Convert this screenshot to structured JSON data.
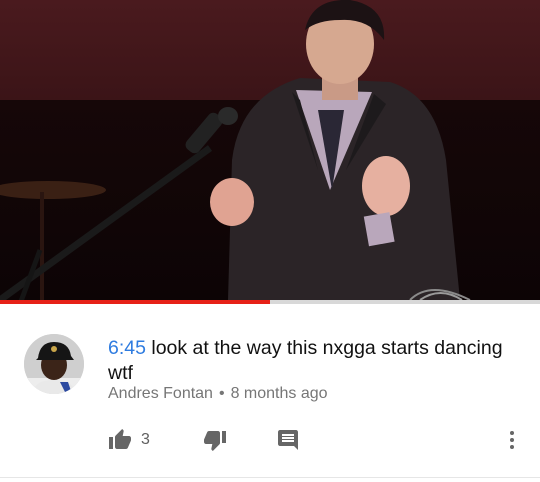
{
  "video": {
    "progress_fraction": 0.5,
    "progress_color": "#e62117"
  },
  "comment": {
    "timestamp": "6:45",
    "text": " look at the way this nxgga starts dancing wtf",
    "author": "Andres Fontan",
    "separator": "•",
    "age": "8 months ago",
    "like_count": "3",
    "link_color": "#2f7ce0"
  },
  "icons": {
    "like": "thumbs-up-icon",
    "dislike": "thumbs-down-icon",
    "reply": "reply-icon",
    "more": "more-vert-icon"
  }
}
